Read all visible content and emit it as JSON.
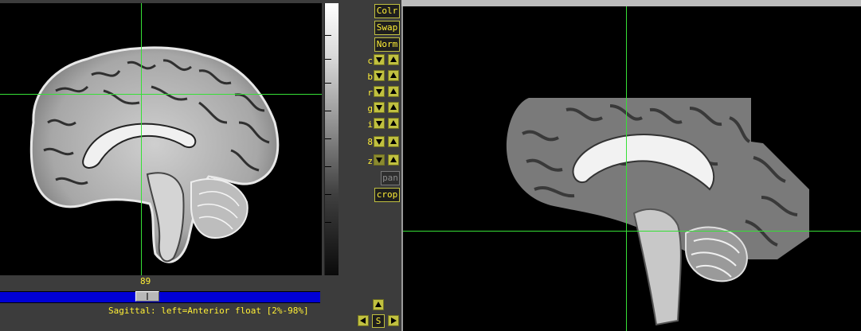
{
  "left_view": {
    "slice_number": "89",
    "status_text": "Sagittal: left=Anterior float [2%-98%]"
  },
  "side_buttons": {
    "colr": "Colr",
    "swap": "Swap",
    "norm": "Norm",
    "pan": "pan",
    "crop": "crop"
  },
  "control_rows": [
    "c",
    "b",
    "r",
    "g",
    "i",
    "8",
    "z"
  ],
  "nav": {
    "center_label": "S"
  },
  "colors": {
    "crosshair": "#36e036",
    "button_text": "#ffef36",
    "slider": "#0000d6"
  }
}
